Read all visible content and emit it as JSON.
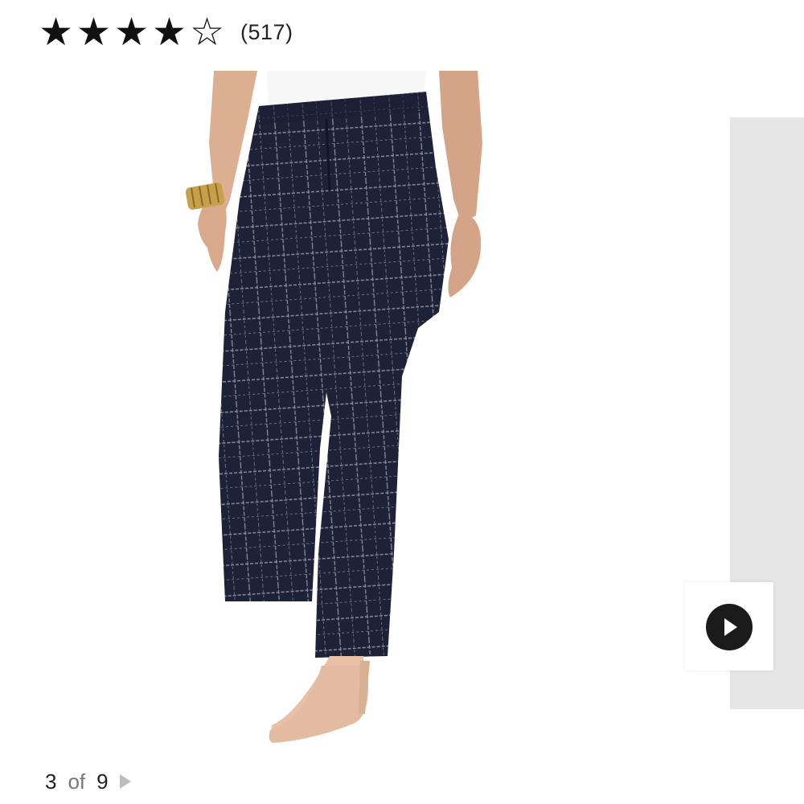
{
  "rating": {
    "stars_filled": 4,
    "stars_total": 5,
    "review_count": "(517)"
  },
  "product_image": {
    "alt": "Plaid navy straight-leg trousers"
  },
  "video": {
    "icon": "play-icon"
  },
  "pager": {
    "current": "3",
    "of": "of",
    "total": "9",
    "next_icon": "chevron-right-icon"
  },
  "colors": {
    "accent": "#111111",
    "panel": "#e6e6e6",
    "pants": "#1e2238"
  }
}
